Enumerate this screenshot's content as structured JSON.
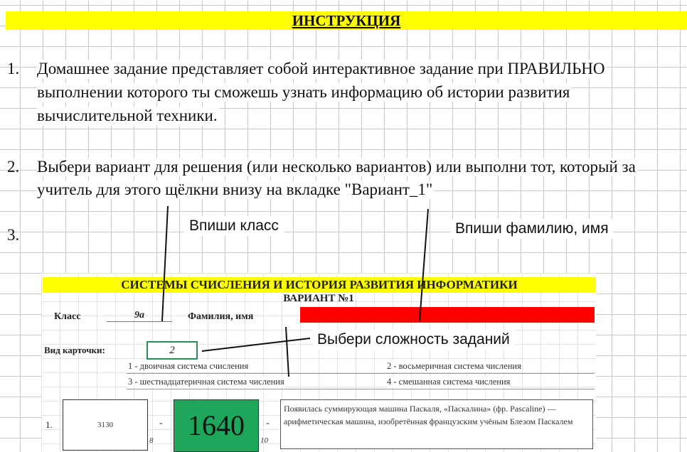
{
  "header": {
    "title": "ИНСТРУКЦИЯ",
    "accent": "#ffff00"
  },
  "steps": [
    {
      "number": "1.",
      "lines": [
        "Домашнее задание представляет собой интерактивное задание при ПРАВИЛЬНО",
        "выполнении которого ты сможешь узнать информацию об истории развития",
        "вычислительной техники."
      ]
    },
    {
      "number": "2.",
      "lines": [
        "Выбери вариант для решения (или несколько вариантов) или выполни тот, который за",
        "учитель для этого щёлкни внизу на вкладке \"Вариант_1\""
      ]
    },
    {
      "number": "3.",
      "lines": []
    }
  ],
  "callouts": {
    "class": "Впиши класс",
    "name": "Впиши фамилию, имя",
    "difficulty": "Выбери сложность заданий"
  },
  "preview": {
    "title": "СИСТЕМЫ СЧИСЛЕНИЯ И ИСТОРИЯ РАЗВИТИЯ ИНФОРМАТИКИ",
    "variant": "ВАРИАНТ №1",
    "class_label": "Класс",
    "class_value": "9а",
    "name_label": "Фамилия, имя",
    "name_field_color": "#ff0000",
    "card_label": "Вид карточки:",
    "card_value": "2",
    "options": [
      "1 - двоичная система счисления",
      "2 - восьмеричная система числения",
      "3 - шестнадцатеричная система числения",
      "4 - смешанная система числения"
    ],
    "task": {
      "number": "1.",
      "input_value": "3130",
      "dash1": "-",
      "sub1": "8",
      "answer": "1640",
      "answer_color": "#1ea65a",
      "dash2": "-",
      "sub2": "10",
      "description": "Появилась суммирующая машина Паскаля, «Паскалина» (фр. Pascaline) — арифметическая машина, изобретённая французским учёным Блезом Паскалем"
    }
  }
}
